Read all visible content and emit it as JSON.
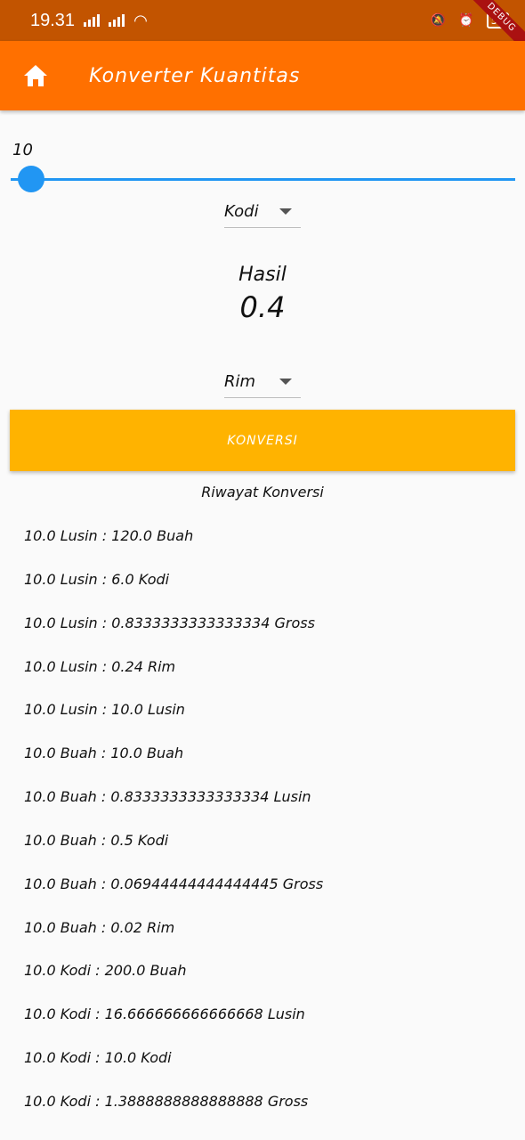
{
  "status": {
    "time": "19.31",
    "battery": "50",
    "debug_label": "DEBUG"
  },
  "appbar": {
    "title": "Konverter Kuantitas",
    "home_icon": "home-icon"
  },
  "slider": {
    "value_label": "10",
    "value": 10,
    "min": 0,
    "max": 100
  },
  "from_unit": {
    "selected": "Kodi"
  },
  "result": {
    "label": "Hasil",
    "value": "0.4"
  },
  "to_unit": {
    "selected": "Rim"
  },
  "convert_button": {
    "label": "KONVERSI"
  },
  "history": {
    "title": "Riwayat Konversi",
    "items": [
      "10.0 Lusin : 120.0 Buah",
      "10.0 Lusin : 6.0 Kodi",
      "10.0 Lusin : 0.8333333333333334 Gross",
      "10.0 Lusin : 0.24 Rim",
      "10.0 Lusin : 10.0 Lusin",
      "10.0 Buah : 10.0 Buah",
      "10.0 Buah : 0.8333333333333334 Lusin",
      "10.0 Buah : 0.5 Kodi",
      "10.0 Buah : 0.06944444444444445 Gross",
      "10.0 Buah : 0.02 Rim",
      "10.0 Kodi : 200.0 Buah",
      "10.0 Kodi : 16.666666666666668 Lusin",
      "10.0 Kodi : 10.0 Kodi",
      "10.0 Kodi : 1.3888888888888888 Gross"
    ]
  },
  "colors": {
    "appbar": "#ff7000",
    "statusbar": "#c25400",
    "slider": "#2196f3",
    "button": "#ffb300"
  }
}
